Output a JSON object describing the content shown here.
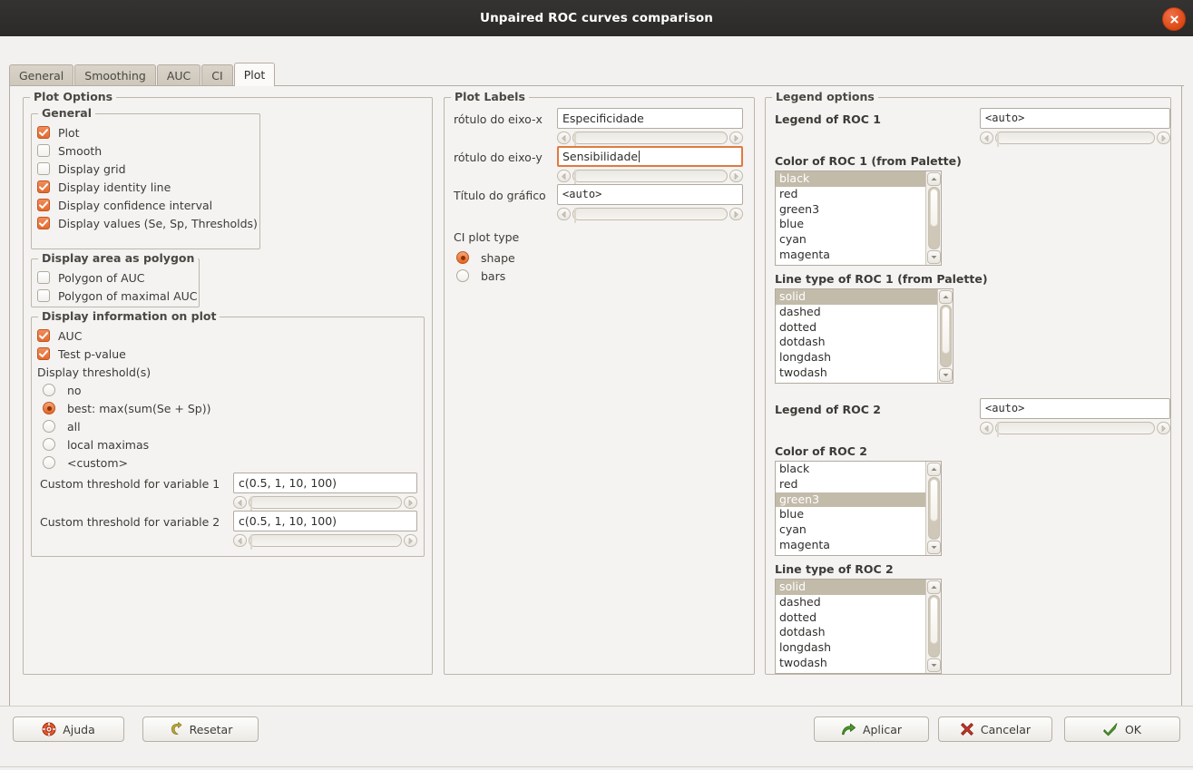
{
  "window": {
    "title": "Unpaired ROC curves comparison",
    "close_icon": "close-icon"
  },
  "tabs": [
    {
      "label": "General",
      "active": false
    },
    {
      "label": "Smoothing",
      "active": false
    },
    {
      "label": "AUC",
      "active": false
    },
    {
      "label": "CI",
      "active": false
    },
    {
      "label": "Plot",
      "active": true
    }
  ],
  "plot_options": {
    "title": "Plot Options",
    "general": {
      "title": "General",
      "items": [
        {
          "label": "Plot",
          "checked": true
        },
        {
          "label": "Smooth",
          "checked": false
        },
        {
          "label": "Display grid",
          "checked": false
        },
        {
          "label": "Display identity line",
          "checked": true
        },
        {
          "label": "Display confidence interval",
          "checked": true
        },
        {
          "label": "Display values (Se, Sp, Thresholds)",
          "checked": true
        }
      ]
    },
    "polygon": {
      "title": "Display area as polygon",
      "items": [
        {
          "label": "Polygon of AUC",
          "checked": false
        },
        {
          "label": "Polygon of maximal AUC",
          "checked": false
        }
      ]
    },
    "info": {
      "title": "Display information on plot",
      "checks": [
        {
          "label": "AUC",
          "checked": true
        },
        {
          "label": "Test p-value",
          "checked": true
        }
      ],
      "threshold_label": "Display threshold(s)",
      "threshold_options": [
        {
          "label": "no",
          "selected": false
        },
        {
          "label": "best: max(sum(Se + Sp))",
          "selected": true
        },
        {
          "label": "all",
          "selected": false
        },
        {
          "label": "local maximas",
          "selected": false
        },
        {
          "label": "<custom>",
          "selected": false
        }
      ],
      "custom1_label": "Custom threshold for variable 1",
      "custom1_value": "c(0.5, 1, 10, 100)",
      "custom2_label": "Custom threshold for variable 2",
      "custom2_value": "c(0.5, 1, 10, 100)"
    }
  },
  "plot_labels": {
    "title": "Plot Labels",
    "xlab_label": "rótulo do eixo-x",
    "xlab_value": "Especificidade",
    "ylab_label": "rótulo do eixo-y",
    "ylab_value": "Sensibilidade",
    "maintitle_label": "Título do gráfico",
    "maintitle_value": "<auto>",
    "ci_plot_type_label": "CI plot type",
    "ci_plot_type_options": [
      {
        "label": "shape",
        "selected": true
      },
      {
        "label": "bars",
        "selected": false
      }
    ]
  },
  "legend_options": {
    "title": "Legend options",
    "roc1": {
      "legend_label": "Legend of ROC 1",
      "legend_value": "<auto>",
      "color_label": "Color of ROC 1 (from Palette)",
      "color_items": [
        "black",
        "red",
        "green3",
        "blue",
        "cyan",
        "magenta"
      ],
      "color_selected": "black",
      "linetype_label": "Line type of ROC 1 (from Palette)",
      "linetype_items": [
        "solid",
        "dashed",
        "dotted",
        "dotdash",
        "longdash",
        "twodash"
      ],
      "linetype_selected": "solid"
    },
    "roc2": {
      "legend_label": "Legend of ROC 2",
      "legend_value": "<auto>",
      "color_label": "Color of ROC 2",
      "color_items": [
        "black",
        "red",
        "green3",
        "blue",
        "cyan",
        "magenta"
      ],
      "color_selected": "green3",
      "linetype_label": "Line type of ROC 2",
      "linetype_items": [
        "solid",
        "dashed",
        "dotted",
        "dotdash",
        "longdash",
        "twodash"
      ],
      "linetype_selected": "solid"
    }
  },
  "buttons": {
    "help": {
      "label": "Ajuda",
      "icon": "lifebuoy-icon"
    },
    "reset": {
      "label": "Resetar",
      "icon": "undo-arrow-icon"
    },
    "apply": {
      "label": "Aplicar",
      "icon": "green-arrow-icon"
    },
    "cancel": {
      "label": "Cancelar",
      "icon": "red-x-icon"
    },
    "ok": {
      "label": "OK",
      "icon": "green-check-icon"
    }
  },
  "colors": {
    "accent": "#dd4814",
    "titlebar": "#2e2d2b",
    "panel": "#f4f3f1",
    "selection": "#c3bbaa"
  }
}
